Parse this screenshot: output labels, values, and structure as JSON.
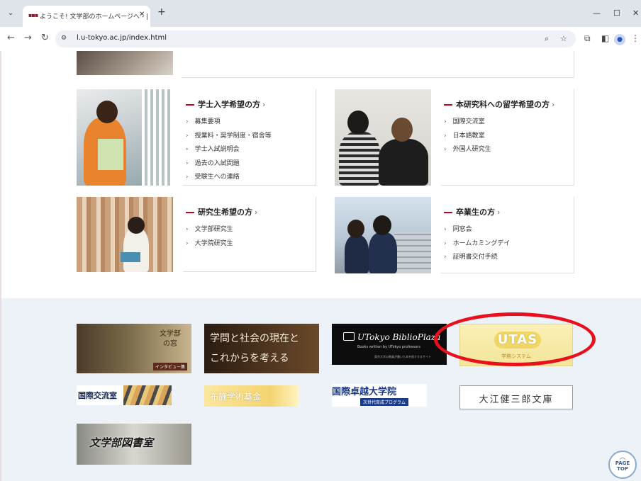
{
  "browser": {
    "tab_title": "ようこそ! 文学部のホームページへ - |",
    "tab_favicon": "▪▪▪",
    "tab_close": "✕",
    "new_tab": "+",
    "url": "l.u-tokyo.ac.jp/index.html",
    "window": {
      "minimize": "—",
      "maximize": "☐",
      "close": "✕"
    }
  },
  "cards": [
    {
      "heading": "学士入学希望の方",
      "links": [
        "募集要項",
        "授業料・奨学制度・宿舎等",
        "学士入試説明会",
        "過去の入試問題",
        "受験生への連絡"
      ]
    },
    {
      "heading": "本研究科への留学希望の方",
      "links": [
        "国際交流室",
        "日本語教室",
        "外国人研究生"
      ]
    },
    {
      "heading": "研究生希望の方",
      "links": [
        "文学部研究生",
        "大学院研究生"
      ]
    },
    {
      "heading": "卒業生の方",
      "links": [
        "同窓会",
        "ホームカミングデイ",
        "証明書交付手続"
      ]
    }
  ],
  "banners": {
    "madoi": {
      "title": "文学部の窓",
      "sub": "インタビュー集"
    },
    "gakumon": {
      "line1": "学問と社会の現在と",
      "line2": "これからを考える"
    },
    "biblio": {
      "title": "UTokyo BiblioPlaza",
      "sub": "Books written by UTokyo professors",
      "sub2": "東京大学の教員が書いた本を紹介するサイト"
    },
    "utas": {
      "logo": "UTAS",
      "sub": "学務システム"
    },
    "kokusai": {
      "title": "国際交流室"
    },
    "fusetsu": {
      "title": "布施学術基金"
    },
    "takuetsu": {
      "title": "国際卓越大学院",
      "sub": "次世代育成プログラム"
    },
    "oe": {
      "title": "大江健三郎文庫"
    },
    "library": {
      "title": "文学部図書室"
    }
  },
  "page_top": {
    "line1": "PAGE",
    "line2": "TOP"
  },
  "colors": {
    "accent": "#c0001e",
    "highlight": "#e8101c",
    "banner_bg": "#edf1f8"
  }
}
